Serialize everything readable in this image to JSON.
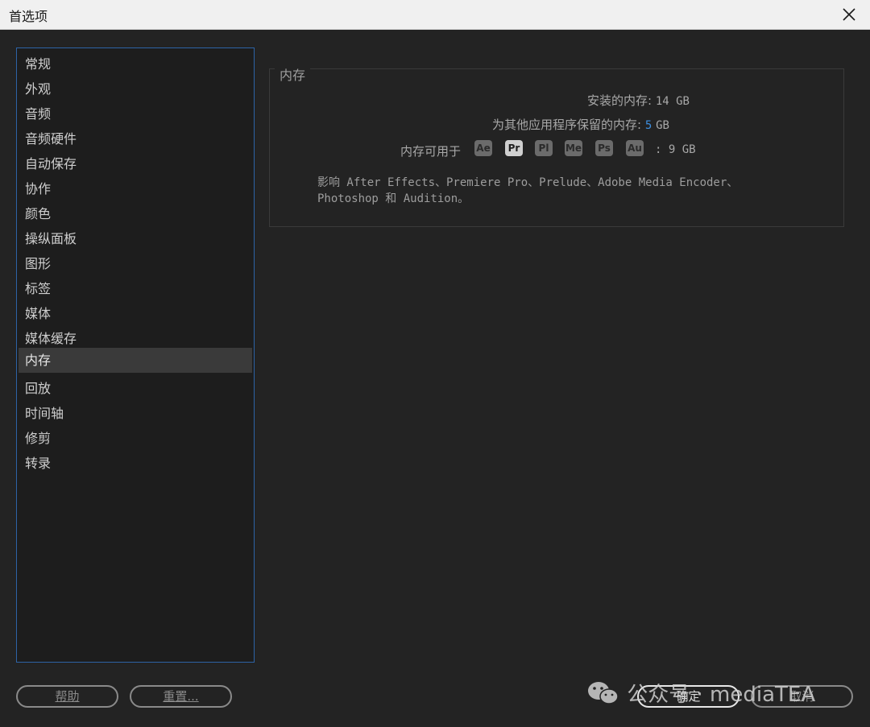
{
  "window": {
    "title": "首选项"
  },
  "sidebar": {
    "items": [
      {
        "label": "常规"
      },
      {
        "label": "外观"
      },
      {
        "label": "音频"
      },
      {
        "label": "音频硬件"
      },
      {
        "label": "自动保存"
      },
      {
        "label": "协作"
      },
      {
        "label": "颜色"
      },
      {
        "label": "操纵面板"
      },
      {
        "label": "图形"
      },
      {
        "label": "标签"
      },
      {
        "label": "媒体"
      },
      {
        "label": "媒体缓存"
      },
      {
        "label": "内存"
      },
      {
        "label": "回放"
      },
      {
        "label": "时间轴"
      },
      {
        "label": "修剪"
      },
      {
        "label": "转录"
      }
    ],
    "selected": "内存"
  },
  "memory": {
    "section_title": "内存",
    "installed_label": "安装的内存:",
    "installed_value": "14 GB",
    "reserved_label": "为其他应用程序保留的内存:",
    "reserved_value": "5",
    "reserved_unit": "GB",
    "available_label": "内存可用于",
    "available_value": ": 9 GB",
    "apps": [
      "Ae",
      "Pr",
      "Pl",
      "Me",
      "Ps",
      "Au"
    ],
    "active_app": "Pr",
    "description_line1": "影响 After Effects、Premiere Pro、Prelude、Adobe Media Encoder、",
    "description_line2": "Photoshop 和 Audition。"
  },
  "buttons": {
    "help": "帮助",
    "reset": "重置...",
    "ok": "确定",
    "cancel": "取消"
  },
  "watermark": {
    "text": "公众号 · mediaTEA"
  },
  "colors": {
    "accent_blue": "#3d8fe0",
    "selection_border": "#2d63a6"
  }
}
